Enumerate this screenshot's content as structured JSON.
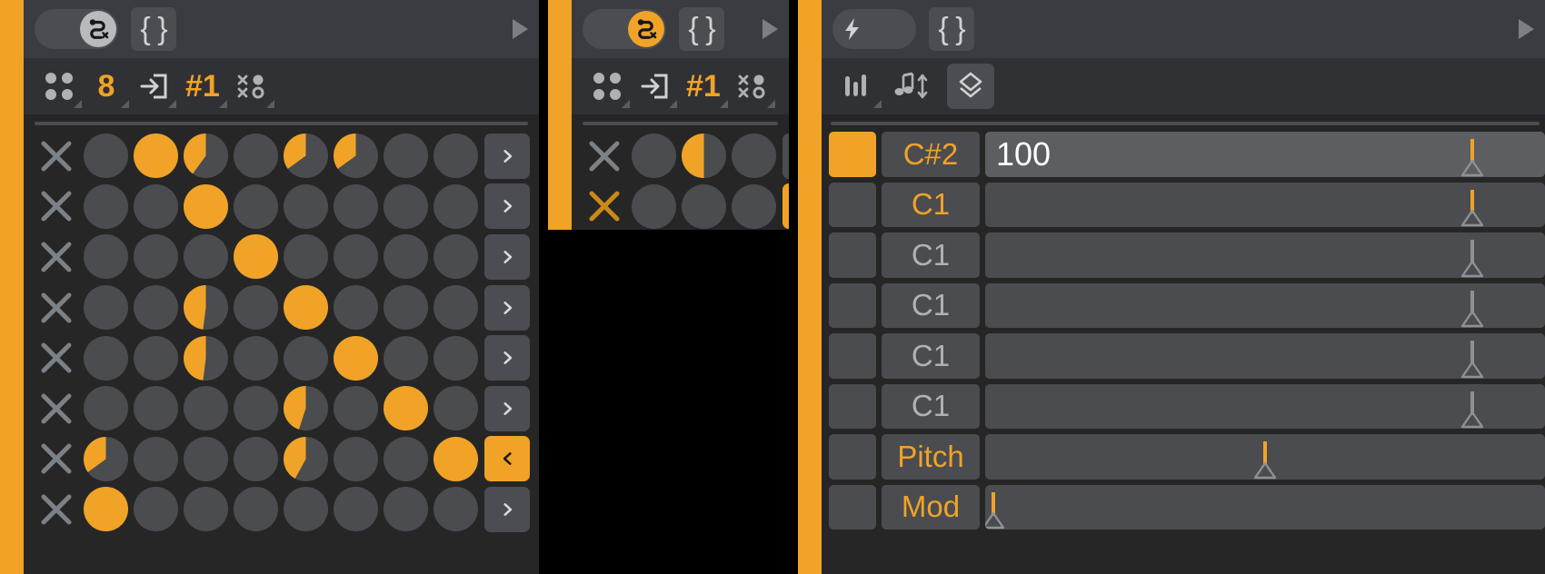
{
  "colors": {
    "accent": "#f0a326",
    "panel_bg": "#262626",
    "header_bg": "#3a3c41",
    "toolbar_bg": "#303134",
    "cell_off": "#4a4c50",
    "text_grey": "#aeb2b6"
  },
  "panels": {
    "left": {
      "header": {
        "toggle_state": "on",
        "toggle_icon": "path-x-icon",
        "braces_label": "{ }",
        "play_icon": "play-icon"
      },
      "toolbar": {
        "items": [
          {
            "name": "grid-size-icon",
            "label": ""
          },
          {
            "name": "steps-value",
            "label": "8"
          },
          {
            "name": "import-icon",
            "label": ""
          },
          {
            "name": "pattern-number",
            "label": "#1"
          },
          {
            "name": "randomize-icon",
            "label": ""
          }
        ]
      },
      "grid": {
        "columns": 8,
        "rows": [
          {
            "mute_state": "off",
            "cells": [
              0,
              1,
              0.4,
              0,
              0.35,
              0.35,
              0,
              0
            ],
            "button": "next",
            "button_active": false
          },
          {
            "mute_state": "off",
            "cells": [
              0,
              0,
              1,
              0,
              0,
              0,
              0,
              0
            ],
            "button": "next",
            "button_active": false
          },
          {
            "mute_state": "off",
            "cells": [
              0,
              0,
              0,
              1,
              0,
              0,
              0,
              0
            ],
            "button": "next",
            "button_active": false
          },
          {
            "mute_state": "off",
            "cells": [
              0,
              0,
              0.48,
              0,
              1,
              0,
              0,
              0
            ],
            "button": "next",
            "button_active": false
          },
          {
            "mute_state": "off",
            "cells": [
              0,
              0,
              0.48,
              0,
              0,
              1,
              0,
              0
            ],
            "button": "next",
            "button_active": false
          },
          {
            "mute_state": "off",
            "cells": [
              0,
              0,
              0,
              0,
              0.45,
              0,
              1,
              0
            ],
            "button": "next",
            "button_active": false
          },
          {
            "mute_state": "off",
            "cells": [
              0.35,
              0,
              0,
              0,
              0.42,
              0,
              0,
              1
            ],
            "button": "prev",
            "button_active": true
          },
          {
            "mute_state": "off",
            "cells": [
              1,
              0,
              0,
              0,
              0,
              0,
              0,
              0
            ],
            "button": "next",
            "button_active": false
          }
        ]
      }
    },
    "middle": {
      "header": {
        "toggle_state": "on-orange",
        "toggle_icon": "path-x-icon",
        "braces_label": "{ }",
        "play_icon": "play-icon"
      },
      "toolbar": {
        "items": [
          {
            "name": "grid-size-icon",
            "label": ""
          },
          {
            "name": "import-icon",
            "label": ""
          },
          {
            "name": "pattern-number",
            "label": "#1"
          },
          {
            "name": "randomize-icon",
            "label": ""
          }
        ]
      },
      "grid": {
        "columns": 3,
        "rows": [
          {
            "mute_state": "off",
            "cells": [
              0,
              0.5
            ],
            "button": "next",
            "button_active": false
          },
          {
            "mute_state": "on",
            "cells": [
              0,
              0
            ],
            "button": "prev",
            "button_active": true
          }
        ]
      }
    },
    "right": {
      "header": {
        "toggle_state": "off",
        "toggle_icon": "lightning-icon",
        "braces_label": "{ }",
        "play_icon": "play-icon"
      },
      "toolbar": {
        "items": [
          {
            "name": "sliders-icon",
            "label": ""
          },
          {
            "name": "note-transpose-icon",
            "label": ""
          },
          {
            "name": "envelope-shape-icon",
            "label": "",
            "active": true
          }
        ]
      },
      "lanes": [
        {
          "enabled": true,
          "note": "C#2",
          "note_active": true,
          "value": "100",
          "highlight": true,
          "marker_pos": 87.0,
          "marker_active": true
        },
        {
          "enabled": false,
          "note": "C1",
          "note_active": true,
          "value": "",
          "highlight": false,
          "marker_pos": 87.0,
          "marker_active": true
        },
        {
          "enabled": false,
          "note": "C1",
          "note_active": false,
          "value": "",
          "highlight": false,
          "marker_pos": 87.0,
          "marker_active": false
        },
        {
          "enabled": false,
          "note": "C1",
          "note_active": false,
          "value": "",
          "highlight": false,
          "marker_pos": 87.0,
          "marker_active": false
        },
        {
          "enabled": false,
          "note": "C1",
          "note_active": false,
          "value": "",
          "highlight": false,
          "marker_pos": 87.0,
          "marker_active": false
        },
        {
          "enabled": false,
          "note": "C1",
          "note_active": false,
          "value": "",
          "highlight": false,
          "marker_pos": 87.0,
          "marker_active": false
        },
        {
          "enabled": false,
          "note": "Pitch",
          "note_active": true,
          "value": "",
          "highlight": false,
          "marker_pos": 50.0,
          "marker_active": true
        },
        {
          "enabled": false,
          "note": "Mod",
          "note_active": true,
          "value": "",
          "highlight": false,
          "marker_pos": 1.5,
          "marker_active": true
        }
      ]
    }
  }
}
